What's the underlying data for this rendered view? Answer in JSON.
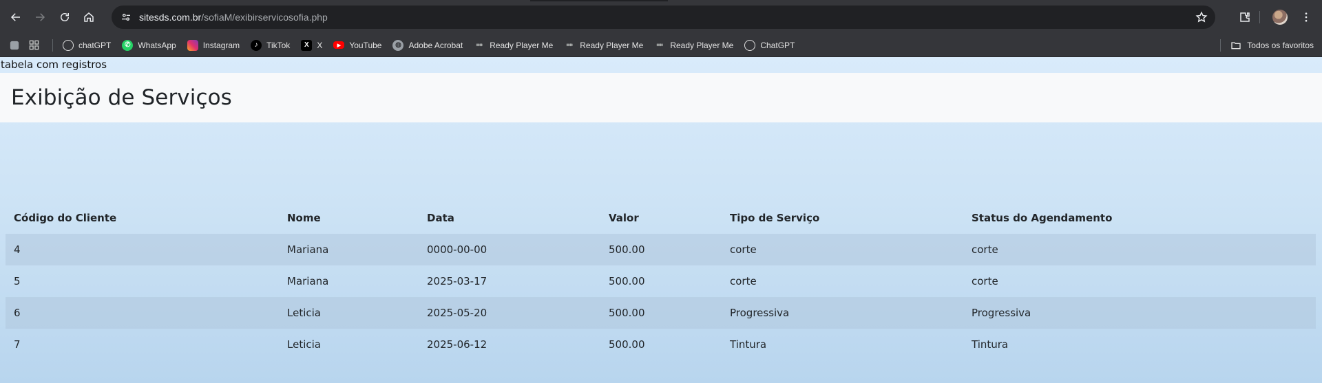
{
  "browser": {
    "url_host": "sitesds.com.br",
    "url_path": "/sofiaM/exibirservicosofia.php",
    "bookmarks": [
      {
        "label": "chatGPT",
        "icon": "chatgpt-icon"
      },
      {
        "label": "WhatsApp",
        "icon": "whatsapp-icon"
      },
      {
        "label": "Instagram",
        "icon": "instagram-icon"
      },
      {
        "label": "TikTok",
        "icon": "tiktok-icon"
      },
      {
        "label": "X",
        "icon": "x-icon"
      },
      {
        "label": "YouTube",
        "icon": "youtube-icon"
      },
      {
        "label": "Adobe Acrobat",
        "icon": "globe-icon"
      },
      {
        "label": "Ready Player Me",
        "icon": "readyplayerme-icon"
      },
      {
        "label": "Ready Player Me",
        "icon": "readyplayerme-icon"
      },
      {
        "label": "Ready Player Me",
        "icon": "readyplayerme-icon"
      },
      {
        "label": "ChatGPT",
        "icon": "chatgpt-icon"
      }
    ],
    "all_bookmarks_label": "Todos os favoritos"
  },
  "page": {
    "raw_label": "tabela com registros",
    "title": "Exibição de Serviços",
    "table": {
      "headers": [
        "Código do Cliente",
        "Nome",
        "Data",
        "Valor",
        "Tipo de Serviço",
        "Status do Agendamento"
      ],
      "rows": [
        [
          "4",
          "Mariana",
          "0000-00-00",
          "500.00",
          "corte",
          "corte"
        ],
        [
          "5",
          "Mariana",
          "2025-03-17",
          "500.00",
          "corte",
          "corte"
        ],
        [
          "6",
          "Leticia",
          "2025-05-20",
          "500.00",
          "Progressiva",
          "Progressiva"
        ],
        [
          "7",
          "Leticia",
          "2025-06-12",
          "500.00",
          "Tintura",
          "Tintura"
        ]
      ]
    }
  }
}
